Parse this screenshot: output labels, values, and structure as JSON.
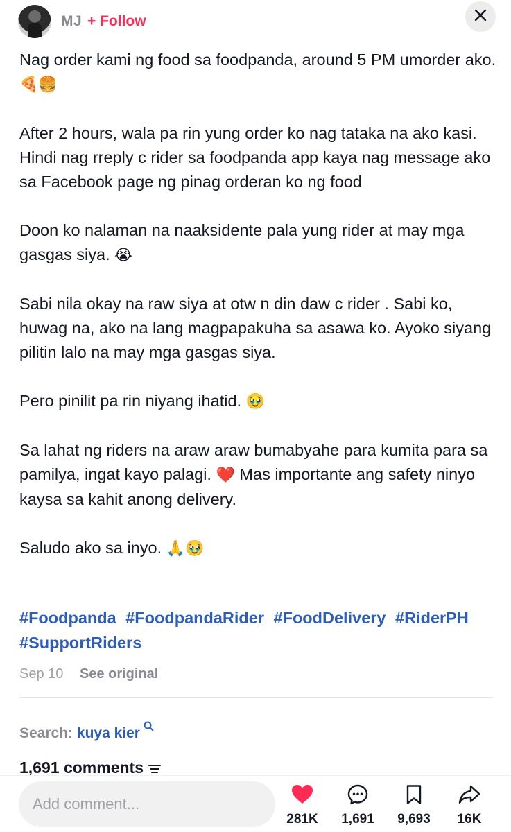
{
  "header": {
    "username": "MJ",
    "follow_label": "+ Follow"
  },
  "post": {
    "paragraphs": [
      {
        "text": "Nag order kami ng food sa foodpanda, around 5 PM umorder ako.",
        "emoji": "🍕🍔"
      },
      {
        "text": "After 2 hours, wala pa rin yung order ko nag tataka na ako kasi. Hindi nag rreply c rider sa foodpanda app kaya nag message ako sa Facebook page ng pinag orderan ko ng food",
        "emoji": ""
      },
      {
        "text": "Doon ko nalaman na naaksidente pala yung rider at may mga gasgas siya.",
        "emoji": "😭"
      },
      {
        "text": "Sabi nila okay na raw siya at otw n din daw c rider . Sabi ko, huwag na, ako na lang magpapakuha sa asawa ko. Ayoko siyang pilitin lalo na may mga gasgas siya.",
        "emoji": ""
      },
      {
        "text": "Pero pinilit pa rin niyang ihatid.",
        "emoji": "🥹"
      },
      {
        "text_before": "Sa lahat ng riders na araw araw bumabyahe para kumita para sa pamilya, ingat kayo palagi.",
        "emoji": "❤️",
        "text_after": "Mas importante ang safety ninyo kaysa sa kahit anong delivery."
      },
      {
        "text": "Saludo ako sa inyo.",
        "emoji": "🙏🥹"
      }
    ],
    "hashtags": [
      "#Foodpanda",
      "#FoodpandaRider",
      "#FoodDelivery",
      "#RiderPH",
      "#SupportRiders"
    ],
    "date": "Sep 10",
    "see_original_label": "See original"
  },
  "search": {
    "label": "Search:",
    "term": "kuya kier"
  },
  "comments_header": {
    "label": "1,691 comments"
  },
  "bottom_bar": {
    "comment_placeholder": "Add comment...",
    "likes": "281K",
    "comments": "1,691",
    "saves": "9,693",
    "shares": "16K"
  },
  "colors": {
    "accent": "#fe2c55",
    "hashtag": "#2b5db9",
    "muted": "#8a8b91"
  },
  "icons": [
    "close-icon",
    "filter-icon",
    "search-icon",
    "heart-icon",
    "comment-icon",
    "bookmark-icon",
    "share-icon"
  ]
}
